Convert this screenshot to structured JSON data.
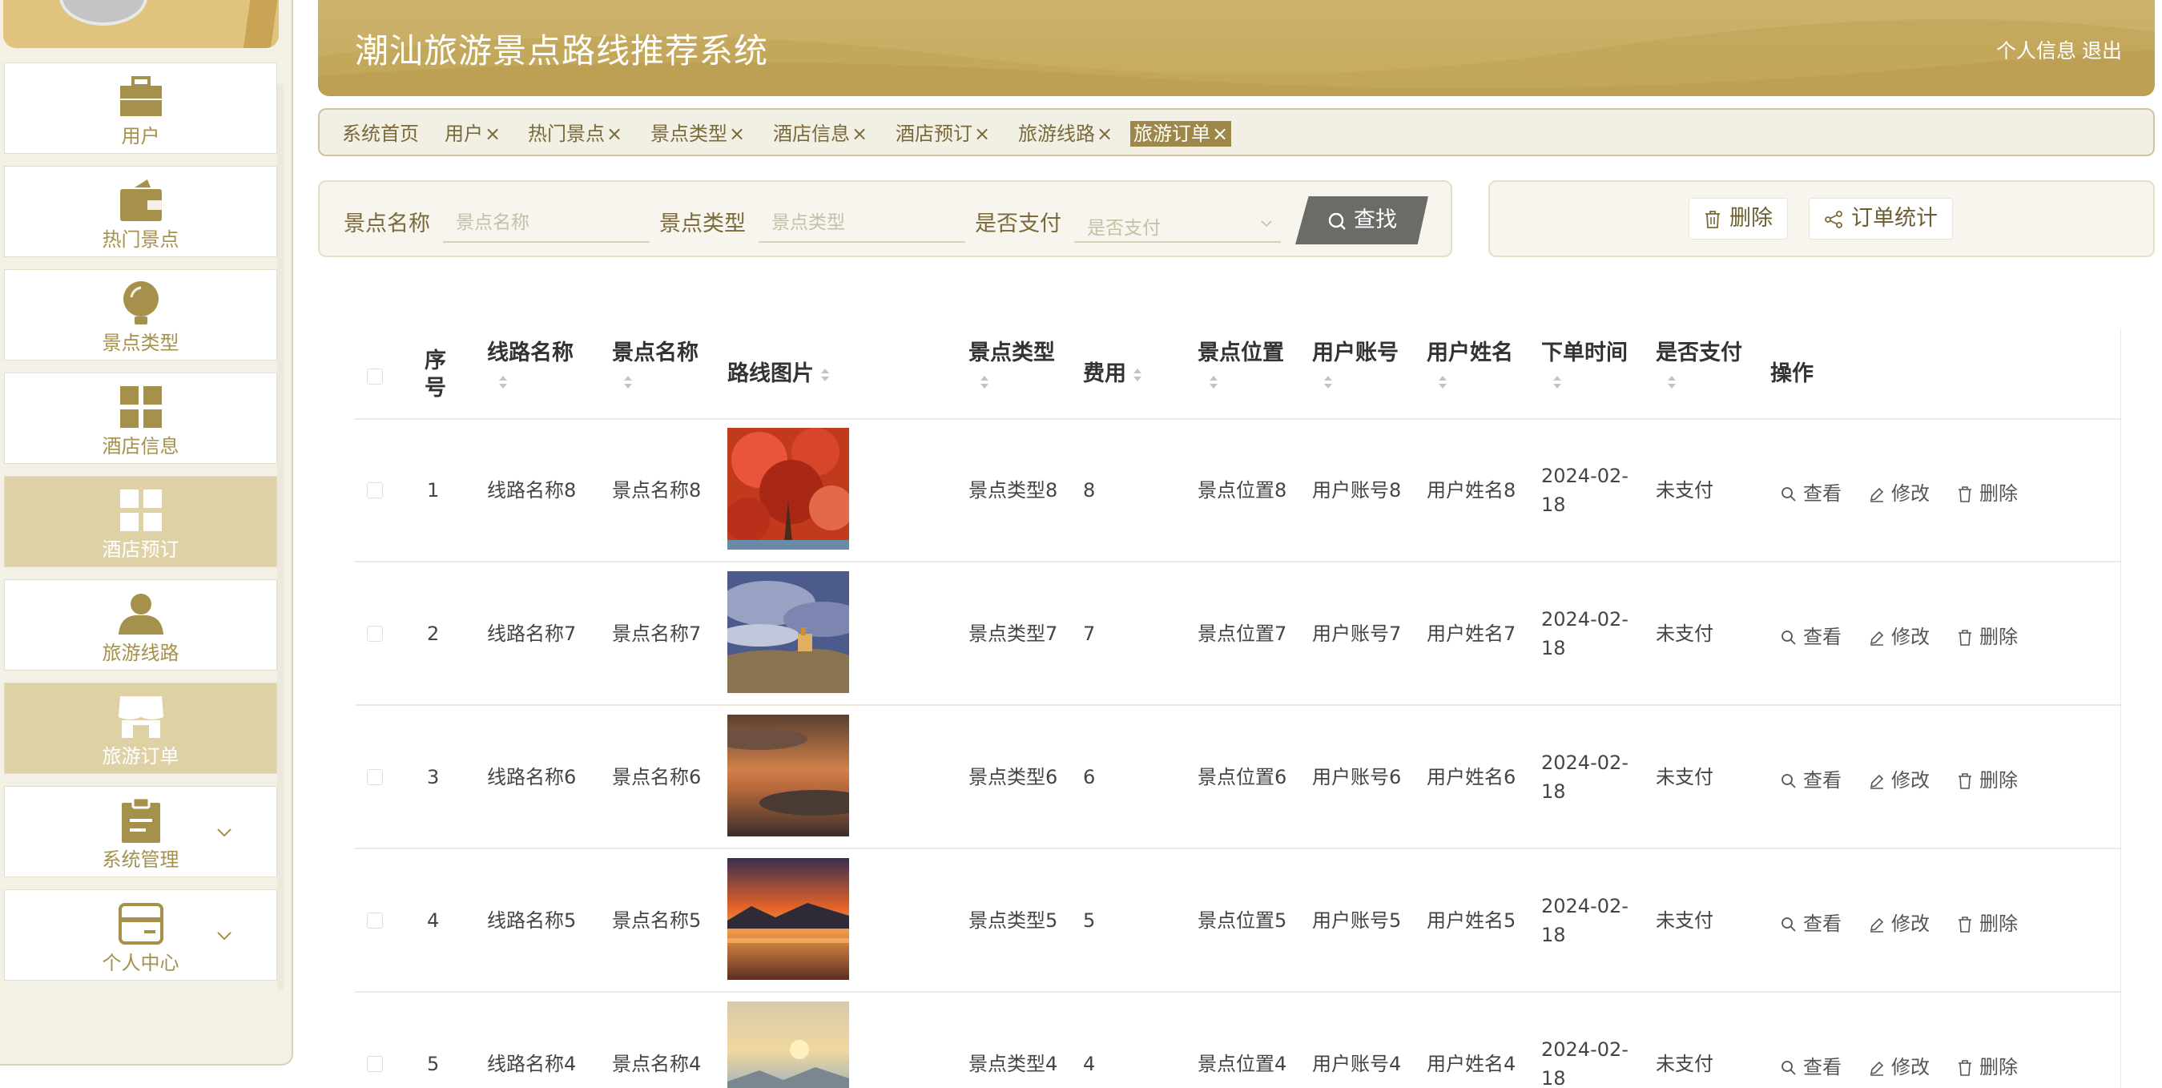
{
  "app": {
    "title": "潮汕旅游景点路线推荐系统",
    "header_links": {
      "profile": "个人信息",
      "logout": "退出"
    },
    "colors": {
      "accent": "#c5a95c",
      "active_tab": "#9e8849",
      "sidebar_active": "#ded1a6",
      "label": "#a5914b"
    }
  },
  "sidebar": {
    "items": [
      {
        "label": "用户",
        "icon": "briefcase-icon",
        "active": false
      },
      {
        "label": "热门景点",
        "icon": "wallet-icon",
        "active": false
      },
      {
        "label": "景点类型",
        "icon": "lightbulb-icon",
        "active": false
      },
      {
        "label": "酒店信息",
        "icon": "grid-icon",
        "active": false
      },
      {
        "label": "酒店预订",
        "icon": "grid-icon",
        "active": true
      },
      {
        "label": "旅游线路",
        "icon": "person-icon",
        "active": false
      },
      {
        "label": "旅游订单",
        "icon": "shop-icon",
        "active": true
      },
      {
        "label": "系统管理",
        "icon": "clipboard-icon",
        "active": false,
        "expandable": true
      },
      {
        "label": "个人中心",
        "icon": "card-icon",
        "active": false,
        "expandable": true
      }
    ]
  },
  "tabs": [
    {
      "label": "系统首页",
      "closable": false
    },
    {
      "label": "用户",
      "closable": true
    },
    {
      "label": "热门景点",
      "closable": true
    },
    {
      "label": "景点类型",
      "closable": true
    },
    {
      "label": "酒店信息",
      "closable": true
    },
    {
      "label": "酒店预订",
      "closable": true
    },
    {
      "label": "旅游线路",
      "closable": true
    },
    {
      "label": "旅游订单",
      "closable": true,
      "active": true
    }
  ],
  "tab_close_glyph": "×",
  "search": {
    "fields": [
      {
        "label": "景点名称",
        "placeholder": "景点名称"
      },
      {
        "label": "景点类型",
        "placeholder": "景点类型"
      },
      {
        "label": "是否支付",
        "placeholder": "是否支付"
      }
    ],
    "button": "查找"
  },
  "actions": {
    "delete": "删除",
    "stats": "订单统计"
  },
  "table": {
    "columns": {
      "index": "序号",
      "route_name": "线路名称",
      "spot_name": "景点名称",
      "image": "路线图片",
      "spot_type": "景点类型",
      "cost": "费用",
      "location": "景点位置",
      "account": "用户账号",
      "user_name": "用户姓名",
      "order_time": "下单时间",
      "paid": "是否支付",
      "ops": "操作"
    },
    "ops": {
      "view": "查看",
      "edit": "修改",
      "delete": "删除"
    },
    "rows": [
      {
        "index": "1",
        "route_name": "线路名称8",
        "spot_name": "景点名称8",
        "image": "red-maple-tree",
        "spot_type": "景点类型8",
        "cost": "8",
        "location": "景点位置8",
        "account": "用户账号8",
        "user_name": "用户姓名8",
        "date_l1": "2024-02-",
        "date_l2": "18",
        "paid": "未支付"
      },
      {
        "index": "2",
        "route_name": "线路名称7",
        "spot_name": "景点名称7",
        "image": "castle-cloudy-sky",
        "spot_type": "景点类型7",
        "cost": "7",
        "location": "景点位置7",
        "account": "用户账号7",
        "user_name": "用户姓名7",
        "date_l1": "2024-02-",
        "date_l2": "18",
        "paid": "未支付"
      },
      {
        "index": "3",
        "route_name": "线路名称6",
        "spot_name": "景点名称6",
        "image": "dusk-clouds",
        "spot_type": "景点类型6",
        "cost": "6",
        "location": "景点位置6",
        "account": "用户账号6",
        "user_name": "用户姓名6",
        "date_l1": "2024-02-",
        "date_l2": "18",
        "paid": "未支付"
      },
      {
        "index": "4",
        "route_name": "线路名称5",
        "spot_name": "景点名称5",
        "image": "sunset-lake",
        "spot_type": "景点类型5",
        "cost": "5",
        "location": "景点位置5",
        "account": "用户账号5",
        "user_name": "用户姓名5",
        "date_l1": "2024-02-",
        "date_l2": "18",
        "paid": "未支付"
      },
      {
        "index": "5",
        "route_name": "线路名称4",
        "spot_name": "景点名称4",
        "image": "misty-mountains",
        "spot_type": "景点类型4",
        "cost": "4",
        "location": "景点位置4",
        "account": "用户账号4",
        "user_name": "用户姓名4",
        "date_l1": "2024-02-",
        "date_l2": "18",
        "paid": "未支付"
      }
    ]
  }
}
